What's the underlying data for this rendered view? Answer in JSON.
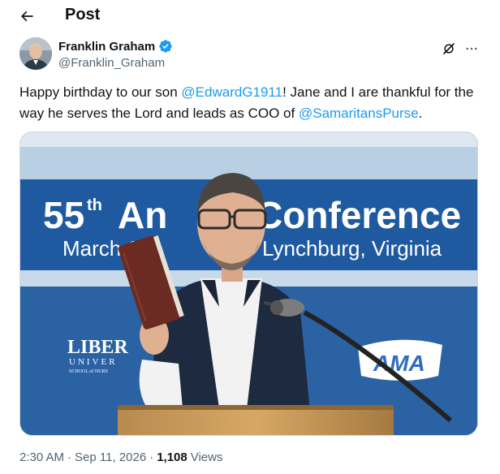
{
  "header": {
    "title": "Post",
    "back_icon": "arrow-left-icon"
  },
  "author": {
    "display_name": "Franklin Graham",
    "handle": "@Franklin_Graham",
    "verified_icon": "verified-badge-icon",
    "verified_color": "#1d9bf0"
  },
  "post": {
    "text_part1": "Happy birthday to our son ",
    "mention1": "@EdwardG1911",
    "text_part2": "! Jane and I are thankful for the way he serves the Lord and leads as COO of ",
    "mention2": "@SamaritansPurse",
    "text_part3": "."
  },
  "media": {
    "banner_line1_a": "55",
    "banner_line1_sup": "th",
    "banner_line1_b": "An",
    "banner_line1_c": "Conference",
    "banner_line2_a": "March 1",
    "banner_line2_b": "Lynchburg, Virginia",
    "logo_left": "LIBER",
    "logo_left_sub": "UNIVER",
    "logo_left_sub2": "SCHOOL of NURS",
    "logo_right": "AMA",
    "banner_color": "#1f5aa0"
  },
  "meta": {
    "time": "2:30 AM",
    "date": "Sep 11, 2026",
    "views_count": "1,108",
    "views_label": "Views",
    "separator": "·"
  },
  "accent_color": "#1d9bf0"
}
